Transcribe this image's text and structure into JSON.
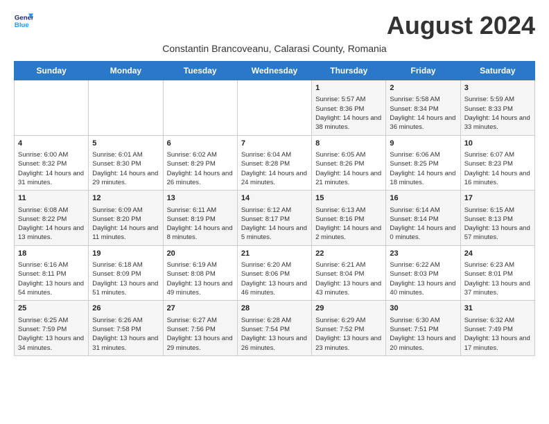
{
  "header": {
    "logo_line1": "General",
    "logo_line2": "Blue",
    "title": "August 2024",
    "subtitle": "Constantin Brancoveanu, Calarasi County, Romania"
  },
  "weekdays": [
    "Sunday",
    "Monday",
    "Tuesday",
    "Wednesday",
    "Thursday",
    "Friday",
    "Saturday"
  ],
  "weeks": [
    [
      {
        "day": "",
        "content": ""
      },
      {
        "day": "",
        "content": ""
      },
      {
        "day": "",
        "content": ""
      },
      {
        "day": "",
        "content": ""
      },
      {
        "day": "1",
        "content": "Sunrise: 5:57 AM\nSunset: 8:36 PM\nDaylight: 14 hours and 38 minutes."
      },
      {
        "day": "2",
        "content": "Sunrise: 5:58 AM\nSunset: 8:34 PM\nDaylight: 14 hours and 36 minutes."
      },
      {
        "day": "3",
        "content": "Sunrise: 5:59 AM\nSunset: 8:33 PM\nDaylight: 14 hours and 33 minutes."
      }
    ],
    [
      {
        "day": "4",
        "content": "Sunrise: 6:00 AM\nSunset: 8:32 PM\nDaylight: 14 hours and 31 minutes."
      },
      {
        "day": "5",
        "content": "Sunrise: 6:01 AM\nSunset: 8:30 PM\nDaylight: 14 hours and 29 minutes."
      },
      {
        "day": "6",
        "content": "Sunrise: 6:02 AM\nSunset: 8:29 PM\nDaylight: 14 hours and 26 minutes."
      },
      {
        "day": "7",
        "content": "Sunrise: 6:04 AM\nSunset: 8:28 PM\nDaylight: 14 hours and 24 minutes."
      },
      {
        "day": "8",
        "content": "Sunrise: 6:05 AM\nSunset: 8:26 PM\nDaylight: 14 hours and 21 minutes."
      },
      {
        "day": "9",
        "content": "Sunrise: 6:06 AM\nSunset: 8:25 PM\nDaylight: 14 hours and 18 minutes."
      },
      {
        "day": "10",
        "content": "Sunrise: 6:07 AM\nSunset: 8:23 PM\nDaylight: 14 hours and 16 minutes."
      }
    ],
    [
      {
        "day": "11",
        "content": "Sunrise: 6:08 AM\nSunset: 8:22 PM\nDaylight: 14 hours and 13 minutes."
      },
      {
        "day": "12",
        "content": "Sunrise: 6:09 AM\nSunset: 8:20 PM\nDaylight: 14 hours and 11 minutes."
      },
      {
        "day": "13",
        "content": "Sunrise: 6:11 AM\nSunset: 8:19 PM\nDaylight: 14 hours and 8 minutes."
      },
      {
        "day": "14",
        "content": "Sunrise: 6:12 AM\nSunset: 8:17 PM\nDaylight: 14 hours and 5 minutes."
      },
      {
        "day": "15",
        "content": "Sunrise: 6:13 AM\nSunset: 8:16 PM\nDaylight: 14 hours and 2 minutes."
      },
      {
        "day": "16",
        "content": "Sunrise: 6:14 AM\nSunset: 8:14 PM\nDaylight: 14 hours and 0 minutes."
      },
      {
        "day": "17",
        "content": "Sunrise: 6:15 AM\nSunset: 8:13 PM\nDaylight: 13 hours and 57 minutes."
      }
    ],
    [
      {
        "day": "18",
        "content": "Sunrise: 6:16 AM\nSunset: 8:11 PM\nDaylight: 13 hours and 54 minutes."
      },
      {
        "day": "19",
        "content": "Sunrise: 6:18 AM\nSunset: 8:09 PM\nDaylight: 13 hours and 51 minutes."
      },
      {
        "day": "20",
        "content": "Sunrise: 6:19 AM\nSunset: 8:08 PM\nDaylight: 13 hours and 49 minutes."
      },
      {
        "day": "21",
        "content": "Sunrise: 6:20 AM\nSunset: 8:06 PM\nDaylight: 13 hours and 46 minutes."
      },
      {
        "day": "22",
        "content": "Sunrise: 6:21 AM\nSunset: 8:04 PM\nDaylight: 13 hours and 43 minutes."
      },
      {
        "day": "23",
        "content": "Sunrise: 6:22 AM\nSunset: 8:03 PM\nDaylight: 13 hours and 40 minutes."
      },
      {
        "day": "24",
        "content": "Sunrise: 6:23 AM\nSunset: 8:01 PM\nDaylight: 13 hours and 37 minutes."
      }
    ],
    [
      {
        "day": "25",
        "content": "Sunrise: 6:25 AM\nSunset: 7:59 PM\nDaylight: 13 hours and 34 minutes."
      },
      {
        "day": "26",
        "content": "Sunrise: 6:26 AM\nSunset: 7:58 PM\nDaylight: 13 hours and 31 minutes."
      },
      {
        "day": "27",
        "content": "Sunrise: 6:27 AM\nSunset: 7:56 PM\nDaylight: 13 hours and 29 minutes."
      },
      {
        "day": "28",
        "content": "Sunrise: 6:28 AM\nSunset: 7:54 PM\nDaylight: 13 hours and 26 minutes."
      },
      {
        "day": "29",
        "content": "Sunrise: 6:29 AM\nSunset: 7:52 PM\nDaylight: 13 hours and 23 minutes."
      },
      {
        "day": "30",
        "content": "Sunrise: 6:30 AM\nSunset: 7:51 PM\nDaylight: 13 hours and 20 minutes."
      },
      {
        "day": "31",
        "content": "Sunrise: 6:32 AM\nSunset: 7:49 PM\nDaylight: 13 hours and 17 minutes."
      }
    ]
  ]
}
